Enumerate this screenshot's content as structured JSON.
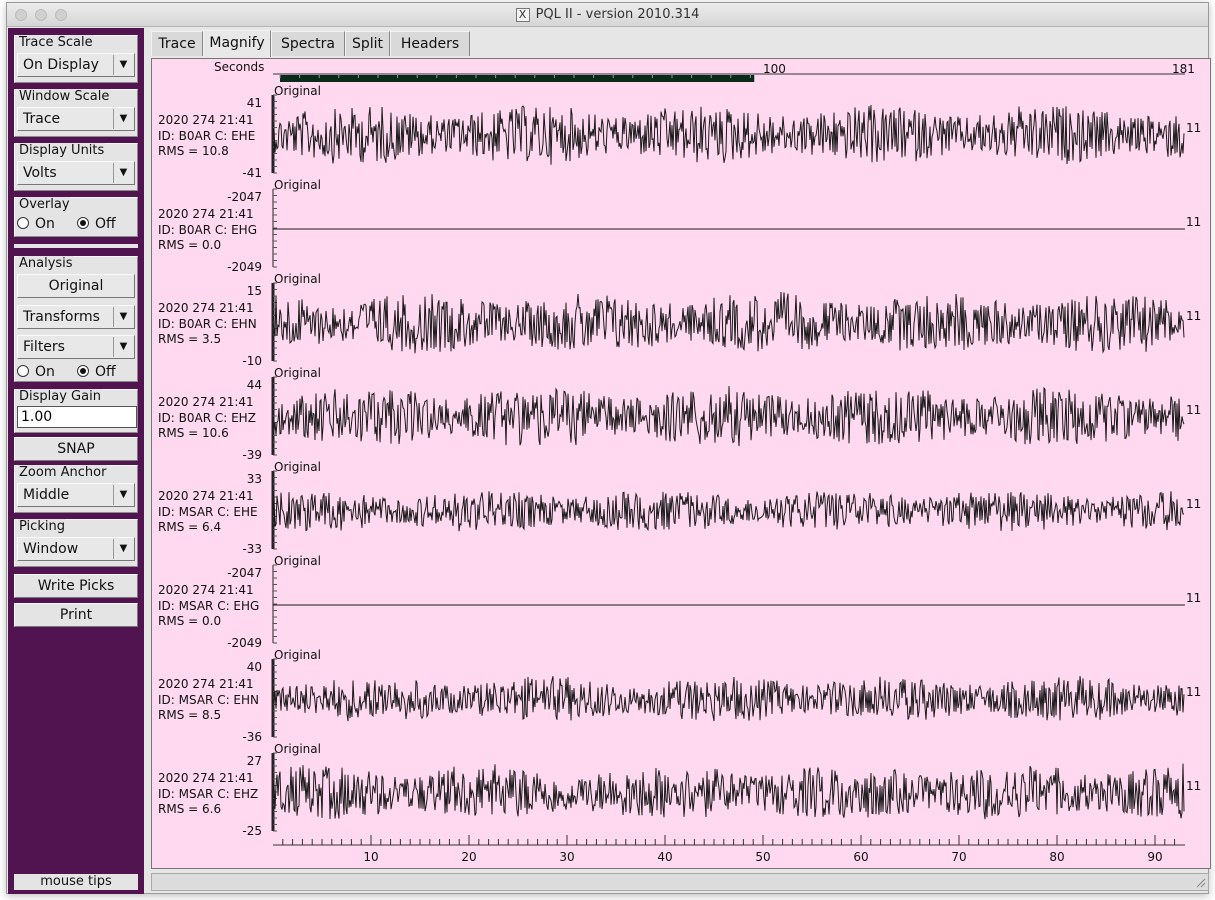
{
  "window": {
    "title": "PQL II - version 2010.314",
    "x_icon": "X"
  },
  "sidebar": {
    "trace_scale": {
      "label": "Trace Scale",
      "value": "On Display"
    },
    "window_scale": {
      "label": "Window Scale",
      "value": "Trace"
    },
    "display_units": {
      "label": "Display Units",
      "value": "Volts"
    },
    "overlay": {
      "label": "Overlay",
      "on": "On",
      "off": "Off",
      "selected": "Off"
    },
    "analysis": {
      "label": "Analysis",
      "original_btn": "Original",
      "transforms": "Transforms",
      "filters": "Filters",
      "on": "On",
      "off": "Off",
      "selected": "Off"
    },
    "display_gain": {
      "label": "Display Gain",
      "value": "1.00"
    },
    "snap": "SNAP",
    "zoom_anchor": {
      "label": "Zoom Anchor",
      "value": "Middle"
    },
    "picking": {
      "label": "Picking",
      "value": "Window"
    },
    "write_picks": "Write Picks",
    "print": "Print",
    "mouse_tips": "mouse tips"
  },
  "tabs": [
    "Trace",
    "Magnify",
    "Spectra",
    "Split",
    "Headers"
  ],
  "active_tab": "Magnify",
  "plot": {
    "top_axis": {
      "label": "Seconds",
      "mid": "100",
      "end": "181",
      "window_fraction": [
        0,
        0.52
      ]
    },
    "x_ticks": [
      "10",
      "20",
      "30",
      "40",
      "50",
      "60",
      "70",
      "80",
      "90"
    ],
    "channel_label": "11",
    "colors": {
      "background": "#ffd9f0",
      "trace": "#1a1a1a",
      "window_bar": "#0b2a1a"
    },
    "traces": [
      {
        "tag": "Original",
        "time": "2020 274 21:41",
        "id": "ID: B0AR C: EHE",
        "rms": "RMS = 10.8",
        "ymax": "41",
        "ymin": "-41",
        "amp": 0.78,
        "flat": false
      },
      {
        "tag": "Original",
        "time": "2020 274 21:41",
        "id": "ID: B0AR C: EHG",
        "rms": "RMS = 0.0",
        "ymax": "-2047",
        "ymin": "-2049",
        "amp": 0,
        "flat": true
      },
      {
        "tag": "Original",
        "time": "2020 274 21:41",
        "id": "ID: B0AR C: EHN",
        "rms": "RMS = 3.5",
        "ymax": "15",
        "ymin": "-10",
        "amp": 0.8,
        "flat": false
      },
      {
        "tag": "Original",
        "time": "2020 274 21:41",
        "id": "ID: B0AR C: EHZ",
        "rms": "RMS = 10.6",
        "ymax": "44",
        "ymin": "-39",
        "amp": 0.8,
        "flat": false
      },
      {
        "tag": "Original",
        "time": "2020 274 21:41",
        "id": "ID: MSAR C: EHE",
        "rms": "RMS = 6.4",
        "ymax": "33",
        "ymin": "-33",
        "amp": 0.55,
        "flat": false
      },
      {
        "tag": "Original",
        "time": "2020 274 21:41",
        "id": "ID: MSAR C: EHG",
        "rms": "RMS = 0.0",
        "ymax": "-2047",
        "ymin": "-2049",
        "amp": 0,
        "flat": true
      },
      {
        "tag": "Original",
        "time": "2020 274 21:41",
        "id": "ID: MSAR C: EHN",
        "rms": "RMS = 8.5",
        "ymax": "40",
        "ymin": "-36",
        "amp": 0.6,
        "flat": false
      },
      {
        "tag": "Original",
        "time": "2020 274 21:41",
        "id": "ID: MSAR C: EHZ",
        "rms": "RMS = 6.6",
        "ymax": "27",
        "ymin": "-25",
        "amp": 0.75,
        "flat": false
      }
    ]
  }
}
